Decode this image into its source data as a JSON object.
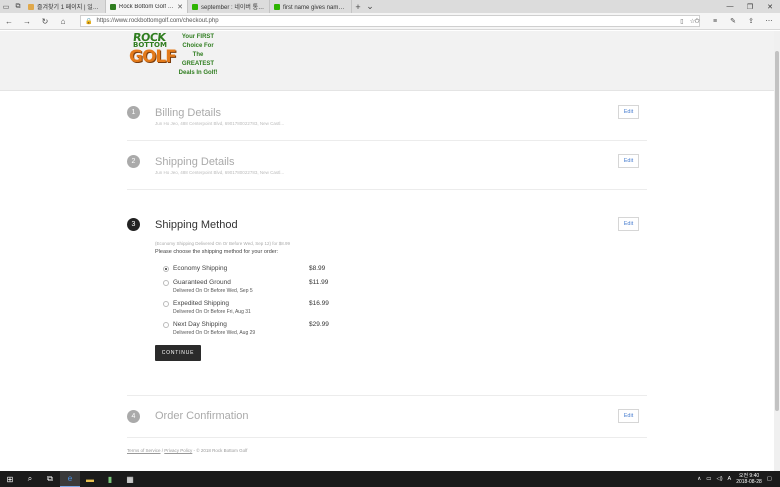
{
  "browser": {
    "tabs": [
      {
        "label": "즐겨찾기 1 페이지 | 일반다",
        "color": "#e0a84a"
      },
      {
        "label": "Rock Bottom Golf - Exp",
        "color": "#2f7d1f",
        "active": true
      },
      {
        "label": "september : 네이버 통합검",
        "color": "#2db400"
      },
      {
        "label": "first name gives name 질문",
        "color": "#2db400"
      }
    ],
    "url": "https://www.rockbottomgolf.com/checkout.php"
  },
  "logo": {
    "rock": "ROCK",
    "bottom": "BOTTOM",
    "golf": "GOLF",
    "tagline": [
      "Your FIRST",
      "Choice For The",
      "GREATEST",
      "Deals In Golf!"
    ]
  },
  "steps": {
    "billing": {
      "num": "1",
      "title": "Billing Details",
      "sub": "Jun Ho Jeo, 488 Centerpoint Blvd, 6901780022783, New Castl...",
      "edit": "Edit"
    },
    "shipping": {
      "num": "2",
      "title": "Shipping Details",
      "sub": "Jun Ho Jeo, 488 Centerpoint Blvd, 6901780022783, New Castl...",
      "edit": "Edit"
    },
    "method": {
      "num": "3",
      "title": "Shipping Method",
      "edit": "Edit",
      "note": "(Economy Shipping Delivered On Or Before Wed, Sep 12) for $8.99",
      "prompt": "Please choose the shipping method for your order:",
      "options": [
        {
          "name": "Economy Shipping",
          "desc": "",
          "price": "$8.99",
          "selected": true
        },
        {
          "name": "Guaranteed Ground",
          "desc": "Delivered On Or Before Wed, Sep 5",
          "price": "$11.99",
          "selected": false
        },
        {
          "name": "Expedited Shipping",
          "desc": "Delivered On Or Before Fri, Aug 31",
          "price": "$16.99",
          "selected": false
        },
        {
          "name": "Next Day Shipping",
          "desc": "Delivered On Or Before Wed, Aug 29",
          "price": "$29.99",
          "selected": false
        }
      ],
      "continue": "CONTINUE"
    },
    "confirm": {
      "num": "4",
      "title": "Order Confirmation",
      "edit": "Edit"
    }
  },
  "footer": {
    "terms": "Terms of Service",
    "sep": " / ",
    "privacy": "Privacy Policy",
    "copy": " - © 2018 Rock Bottom Golf"
  },
  "taskbar": {
    "time": "오전 9:40",
    "date": "2018-08-28",
    "lang": "A"
  }
}
